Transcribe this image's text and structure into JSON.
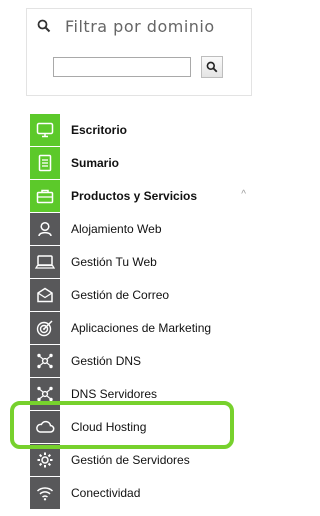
{
  "domain_filter": {
    "header_placeholder": "Filtra por dominio",
    "input_value": "",
    "button_icon": "search-icon"
  },
  "menu": {
    "items": [
      {
        "label": "Escritorio",
        "icon": "monitor-icon",
        "active": true,
        "bold": true
      },
      {
        "label": "Sumario",
        "icon": "document-icon",
        "active": true,
        "bold": true
      },
      {
        "label": "Productos y Servicios",
        "icon": "briefcase-icon",
        "active": true,
        "bold": true,
        "expanded": true,
        "caret": "^"
      },
      {
        "label": "Alojamiento Web",
        "icon": "user-hosting-icon",
        "active": false
      },
      {
        "label": "Gestión Tu Web",
        "icon": "laptop-icon",
        "active": false
      },
      {
        "label": "Gestión de Correo",
        "icon": "mail-icon",
        "active": false
      },
      {
        "label": "Aplicaciones de Marketing",
        "icon": "target-icon",
        "active": false
      },
      {
        "label": "Gestión DNS",
        "icon": "network-icon",
        "active": false
      },
      {
        "label": "DNS Servidores",
        "icon": "network-icon",
        "active": false
      },
      {
        "label": "Cloud Hosting",
        "icon": "cloud-icon",
        "active": false,
        "highlighted": true
      },
      {
        "label": "Gestión de Servidores",
        "icon": "gear-icon",
        "active": false
      },
      {
        "label": "Conectividad",
        "icon": "wifi-icon",
        "active": false
      }
    ]
  },
  "colors": {
    "active_green": "#5cc92a",
    "icon_gray": "#58585a",
    "highlight_green": "#77d12d"
  }
}
